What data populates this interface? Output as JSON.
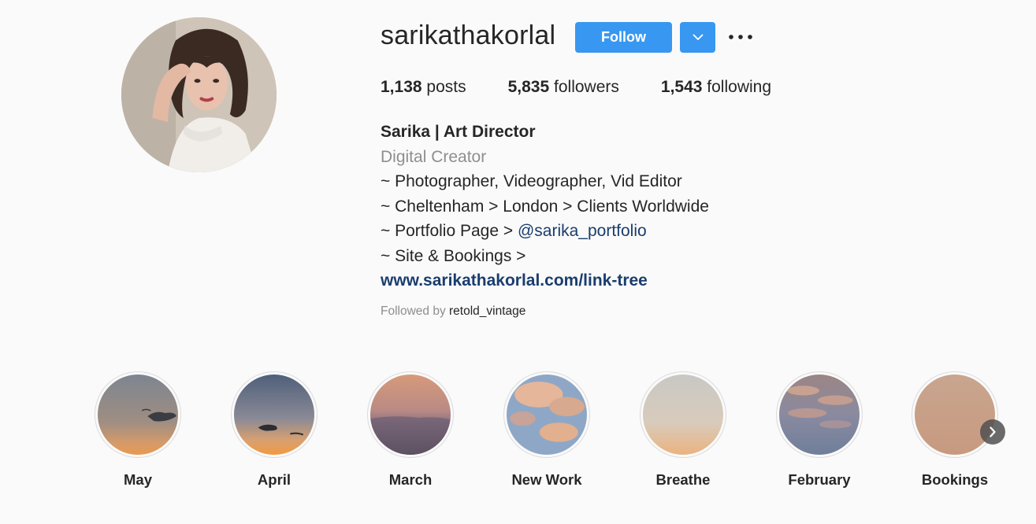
{
  "profile": {
    "username": "sarikathakorlal",
    "follow_label": "Follow",
    "avatar_icon": "profile-photo",
    "dropdown_icon": "chevron-down-icon",
    "more_icon": "more-horizontal-icon"
  },
  "stats": [
    {
      "count": "1,138",
      "label": "posts"
    },
    {
      "count": "5,835",
      "label": "followers"
    },
    {
      "count": "1,543",
      "label": "following"
    }
  ],
  "bio": {
    "name": "Sarika | Art Director",
    "category": "Digital Creator",
    "line1": "~ Photographer, Videographer, Vid Editor",
    "line2": "~ Cheltenham > London > Clients Worldwide",
    "line3_prefix": "~ Portfolio Page > ",
    "line3_mention": "@sarika_portfolio",
    "line4": "~ Site & Bookings >",
    "link": "www.sarikathakorlal.com/link-tree"
  },
  "followed_by": {
    "prefix": "Followed by ",
    "user": "retold_vintage"
  },
  "highlights": [
    {
      "label": "May"
    },
    {
      "label": "April"
    },
    {
      "label": "March"
    },
    {
      "label": "New Work"
    },
    {
      "label": "Breathe"
    },
    {
      "label": "February"
    },
    {
      "label": "Bookings"
    }
  ],
  "highlights_next_icon": "chevron-right-icon",
  "colors": {
    "accent": "#3897f0",
    "link": "#1a3d6e",
    "muted": "#8e8e8e",
    "text": "#262626",
    "background": "#fafafa"
  }
}
